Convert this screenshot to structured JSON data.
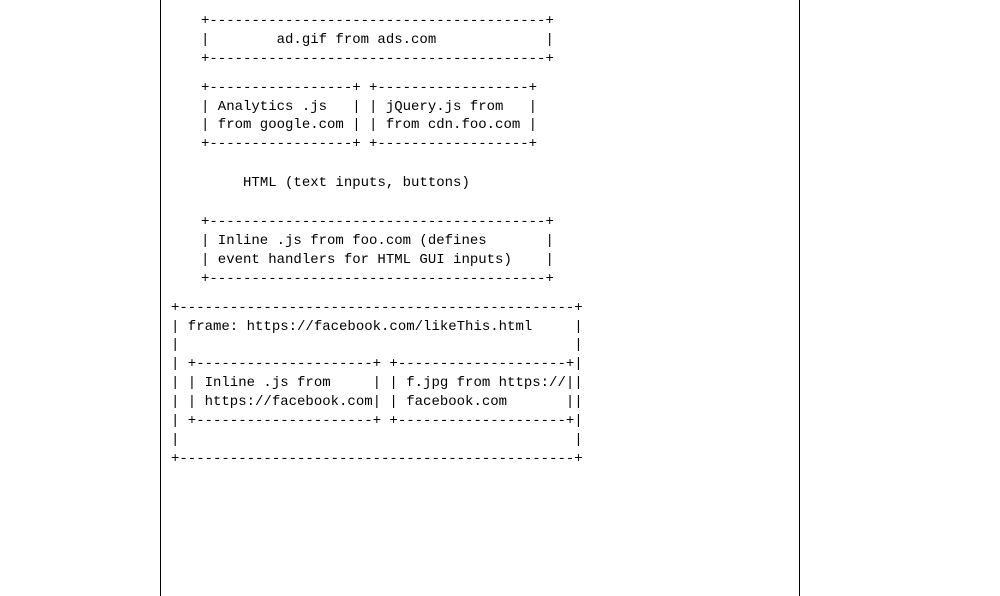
{
  "diagram": {
    "ad_box": {
      "top": "+----------------------------------------+",
      "line1": "|        ad.gif from ads.com             |",
      "bottom": "+----------------------------------------+"
    },
    "scripts_row": {
      "top": "+-----------------+ +------------------+",
      "line1": "| Analytics .js   | | jQuery.js from   |",
      "line2": "| from google.com | | from cdn.foo.com |",
      "bottom": "+-----------------+ +------------------+"
    },
    "html_label": "HTML (text inputs, buttons)",
    "inline_foo": {
      "top": "+----------------------------------------+",
      "line1": "| Inline .js from foo.com (defines       |",
      "line2": "| event handlers for HTML GUI inputs)    |",
      "bottom": "+----------------------------------------+"
    },
    "frame_fb": {
      "top": "+-----------------------------------------------+",
      "title": "| frame: https://facebook.com/likeThis.html     |",
      "blank": "|                                               |",
      "rowtop": "| +---------------------+ +--------------------+|",
      "row1": "| | Inline .js from     | | f.jpg from https://||",
      "row2": "| | https://facebook.com| | facebook.com       ||",
      "rowbot": "| +---------------------+ +--------------------+|",
      "bottom": "+-----------------------------------------------+"
    }
  }
}
